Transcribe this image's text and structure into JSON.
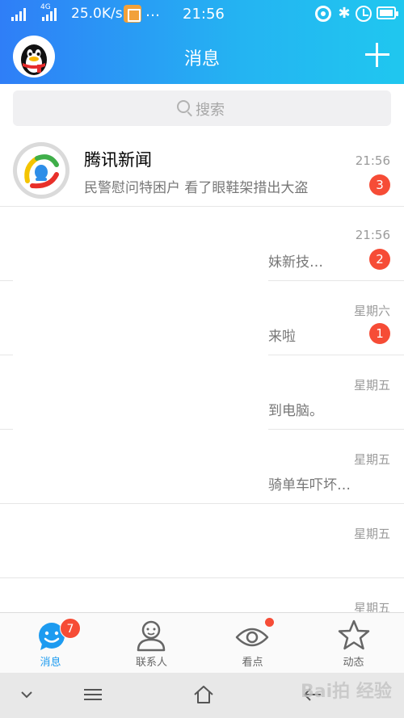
{
  "status_bar": {
    "network": "4G",
    "speed": "25.0K/s",
    "more": "…",
    "time": "21:56",
    "bluetooth": "✱"
  },
  "header": {
    "title": "消息"
  },
  "search": {
    "placeholder": "搜索"
  },
  "conversations": [
    {
      "name": "腾讯新闻",
      "message": "民警慰问特困户 看了眼鞋架措出大盗",
      "time": "21:56",
      "badge": "3"
    },
    {
      "name": "",
      "message": "妹新技…",
      "time": "21:56",
      "badge": "2"
    },
    {
      "name": "",
      "message": "来啦",
      "time": "星期六",
      "badge": "1"
    },
    {
      "name": "",
      "message": "到电脑。",
      "time": "星期五",
      "badge": ""
    },
    {
      "name": "",
      "message": "骑单车吓坏…",
      "time": "星期五",
      "badge": ""
    },
    {
      "name": "",
      "message": "",
      "time": "星期五",
      "badge": ""
    },
    {
      "name": "",
      "message": "",
      "time": "星期五",
      "badge": ""
    }
  ],
  "tabs": [
    {
      "label": "消息",
      "badge": "7",
      "icon": "message-bubble-icon"
    },
    {
      "label": "联系人",
      "icon": "contacts-icon"
    },
    {
      "label": "看点",
      "icon": "eye-icon"
    },
    {
      "label": "动态",
      "icon": "star-icon"
    }
  ],
  "system_nav": {
    "watermark": "Bai拍 经验"
  },
  "colors": {
    "header_start": "#2f7ef7",
    "header_end": "#20c7ef",
    "badge": "#f64c36",
    "active_tab": "#1d9bf0"
  }
}
